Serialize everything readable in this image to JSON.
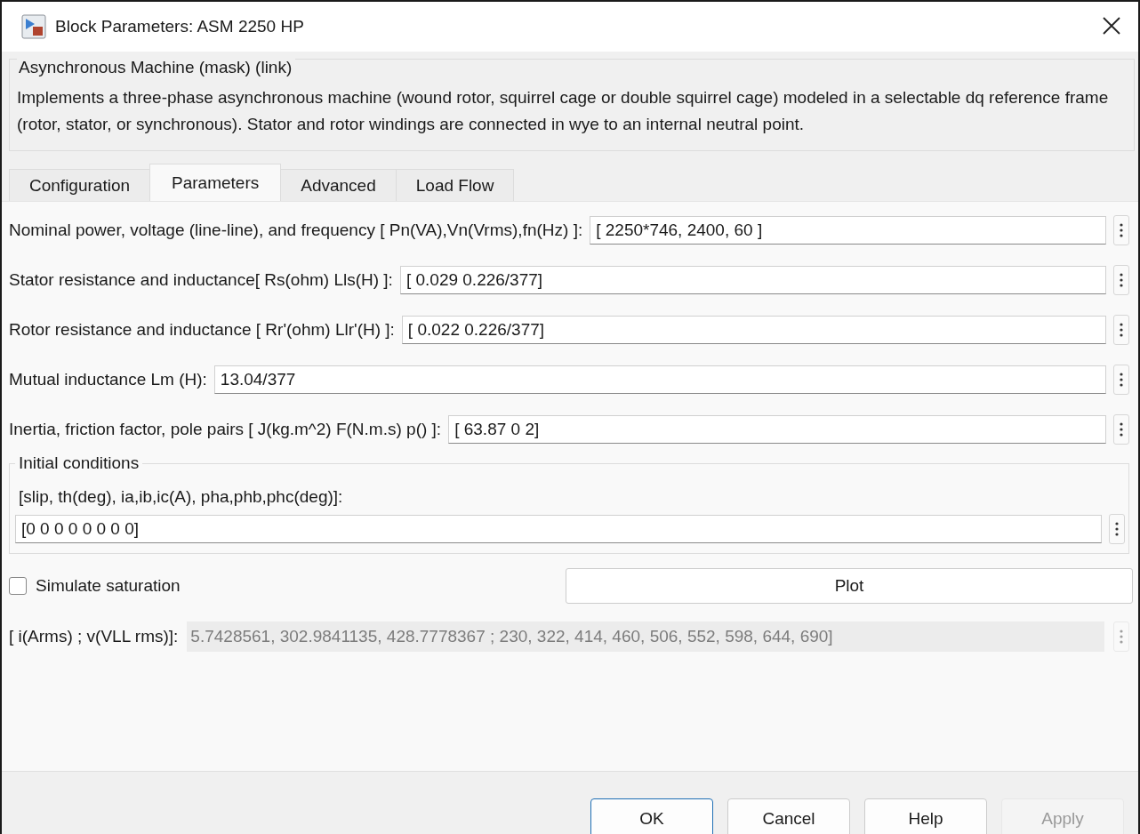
{
  "window": {
    "title": "Block Parameters: ASM 2250 HP"
  },
  "description": {
    "title": "Asynchronous Machine (mask) (link)",
    "text": "Implements a three-phase asynchronous machine (wound rotor, squirrel cage or double squirrel cage) modeled in a selectable dq reference frame (rotor, stator, or synchronous). Stator and rotor windings are connected in wye to an internal neutral point."
  },
  "tabs": [
    {
      "label": "Configuration",
      "selected": false
    },
    {
      "label": "Parameters",
      "selected": true
    },
    {
      "label": "Advanced",
      "selected": false
    },
    {
      "label": "Load Flow",
      "selected": false
    }
  ],
  "parameters": [
    {
      "label": "Nominal power, voltage (line-line), and frequency [ Pn(VA),Vn(Vrms),fn(Hz) ]:",
      "value": "[ 2250*746, 2400, 60 ]"
    },
    {
      "label": "Stator resistance and inductance[ Rs(ohm)  Lls(H) ]:",
      "value": "[ 0.029 0.226/377]"
    },
    {
      "label": "Rotor resistance and inductance [ Rr'(ohm)  Llr'(H) ]:",
      "value": "[ 0.022 0.226/377]"
    },
    {
      "label": "Mutual inductance Lm (H):",
      "value": "13.04/377"
    },
    {
      "label": "Inertia, friction factor, pole pairs [ J(kg.m^2)  F(N.m.s)  p() ]:",
      "value": "[ 63.87 0 2]"
    }
  ],
  "initial_conditions": {
    "title": "Initial conditions",
    "label": "[slip, th(deg), ia,ib,ic(A), pha,phb,phc(deg)]:",
    "value": "[0 0 0 0 0 0 0 0]"
  },
  "saturation": {
    "label": "Simulate saturation",
    "checked": false
  },
  "plot_button": {
    "label": "Plot"
  },
  "saturation_data": {
    "label": "[ i(Arms) ; v(VLL rms)]:",
    "value": "5.7428561, 302.9841135, 428.7778367 ; 230, 322, 414, 460, 506, 552, 598, 644, 690]",
    "disabled": true
  },
  "buttons": [
    {
      "label": "OK",
      "default": true,
      "disabled": false
    },
    {
      "label": "Cancel",
      "default": false,
      "disabled": false
    },
    {
      "label": "Help",
      "default": false,
      "disabled": false
    },
    {
      "label": "Apply",
      "default": false,
      "disabled": true
    }
  ]
}
